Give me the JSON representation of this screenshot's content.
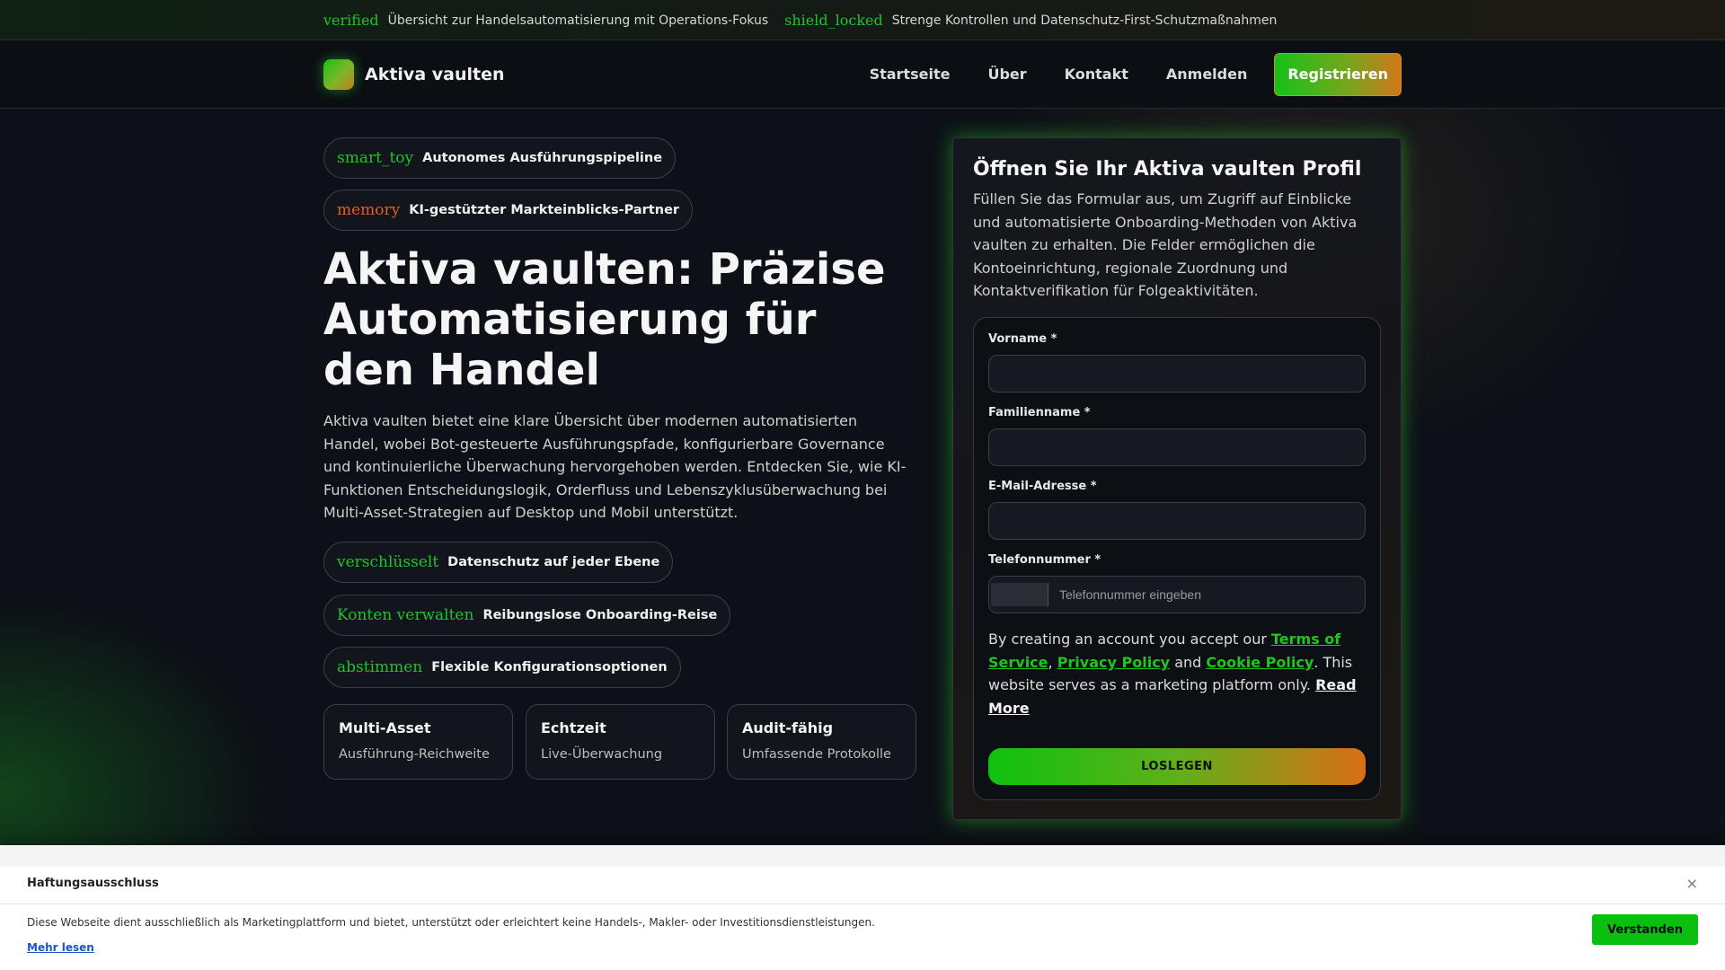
{
  "topstrip": {
    "items": [
      {
        "icon": "verified",
        "text": "Übersicht zur Handelsautomatisierung mit Operations-Fokus"
      },
      {
        "icon": "shield_locked",
        "text": "Strenge Kontrollen und Datenschutz-First-Schutzmaßnahmen"
      }
    ]
  },
  "header": {
    "brand": "Aktiva vaulten",
    "nav": [
      "Startseite",
      "Über",
      "Kontakt",
      "Anmelden"
    ],
    "register": "Registrieren"
  },
  "hero": {
    "badges": [
      {
        "icon": "smart_toy",
        "label": "Autonomes Ausführungspipeline"
      },
      {
        "icon": "memory",
        "label": "KI-gestützter Markteinblicks-Partner"
      }
    ],
    "title": "Aktiva vaulten: Präzise Automatisierung für den Handel",
    "description": "Aktiva vaulten bietet eine klare Übersicht über modernen automatisierten Handel, wobei Bot-gesteuerte Ausführungspfade, konfigurierbare Governance und kontinuierliche Überwachung hervorgehoben werden. Entdecken Sie, wie KI-Funktionen Entscheidungslogik, Orderfluss und Lebenszyklusüberwachung bei Multi-Asset-Strategien auf Desktop und Mobil unterstützt.",
    "features": [
      {
        "icon": "verschlüsselt",
        "label": "Datenschutz auf jeder Ebene"
      },
      {
        "icon": "Konten verwalten",
        "label": "Reibungslose Onboarding-Reise"
      },
      {
        "icon": "abstimmen",
        "label": "Flexible Konfigurationsoptionen"
      }
    ],
    "stats": [
      {
        "title": "Multi-Asset",
        "sub": "Ausführung-Reichweite"
      },
      {
        "title": "Echtzeit",
        "sub": "Live-Überwachung"
      },
      {
        "title": "Audit-fähig",
        "sub": "Umfassende Protokolle"
      }
    ]
  },
  "form": {
    "title": "Öffnen Sie Ihr Aktiva vaulten Profil",
    "description": "Füllen Sie das Formular aus, um Zugriff auf Einblicke und automatisierte Onboarding-Methoden von Aktiva vaulten zu erhalten. Die Felder ermöglichen die Kontoeinrichtung, regionale Zuordnung und Kontaktverifikation für Folgeaktivitäten.",
    "first_name_label": "Vorname *",
    "last_name_label": "Familienname *",
    "email_label": "E-Mail-Adresse *",
    "phone_label": "Telefonnummer *",
    "phone_placeholder": "Telefonnummer eingeben",
    "consent_prefix": "By creating an account you accept our ",
    "terms": "Terms of Service",
    "sep1": ", ",
    "privacy": "Privacy Policy",
    "sep2": " and ",
    "cookie": "Cookie Policy",
    "consent_suffix": ". This website serves as a marketing platform only. ",
    "read_more": "Read More",
    "submit": "LOSLEGEN"
  },
  "disclaimer": {
    "title": "Haftungsausschluss",
    "close": "×",
    "text": "Diese Webseite dient ausschließlich als Marketingplattform und bietet, unterstützt oder erleichtert keine Handels-, Makler- oder Investitionsdienstleistungen.",
    "more": "Mehr lesen",
    "ok": "Verstanden"
  }
}
